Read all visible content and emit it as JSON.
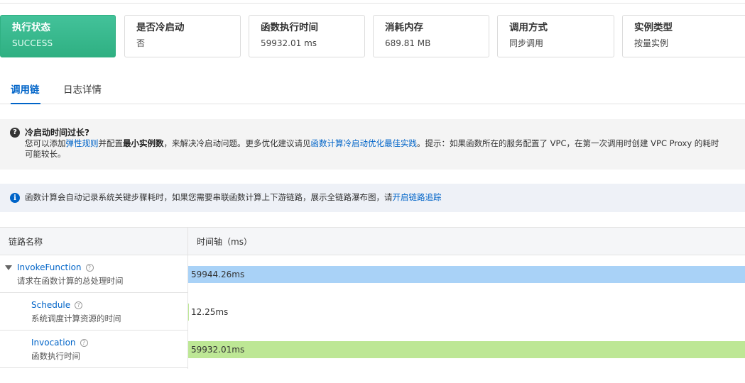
{
  "summary": {
    "status": {
      "title": "执行状态",
      "value": "SUCCESS"
    },
    "cold_start": {
      "title": "是否冷启动",
      "value": "否"
    },
    "duration": {
      "title": "函数执行时间",
      "value": "59932.01 ms"
    },
    "memory": {
      "title": "消耗内存",
      "value": "689.81 MB"
    },
    "invoke_type": {
      "title": "调用方式",
      "value": "同步调用"
    },
    "instance_type": {
      "title": "实例类型",
      "value": "按量实例"
    }
  },
  "tabs": [
    {
      "label": "调用链",
      "active": true
    },
    {
      "label": "日志详情",
      "active": false
    }
  ],
  "cold_tip": {
    "title": "冷启动时间过长?",
    "part1": "您可以添加",
    "link1": "弹性规则",
    "part2": "并配置",
    "bold": "最小实例数",
    "part3": "，来解决冷启动问题。更多优化建议请见",
    "link2": "函数计算冷启动优化最佳实践",
    "part4": "。提示：如果函数所在的服务配置了 VPC，在第一次调用时创建 VPC Proxy 的耗时可能较长。"
  },
  "info": {
    "text": "函数计算会自动记录系统关键步骤耗时，如果您需要串联函数计算上下游链路，展示全链路瀑布图，请",
    "link": "开启链路追踪"
  },
  "table": {
    "col_name": "链路名称",
    "col_time": "时间轴（ms）"
  },
  "spans": [
    {
      "name": "InvokeFunction",
      "desc": "请求在函数计算的总处理时间",
      "label": "59944.26ms",
      "duration_ms": 59944.26,
      "color": "#a9d2f7"
    },
    {
      "name": "Schedule",
      "desc": "系统调度计算资源的时间",
      "label": "12.25ms",
      "duration_ms": 12.25,
      "color": "#bde795"
    },
    {
      "name": "Invocation",
      "desc": "函数执行时间",
      "label": "59932.01ms",
      "duration_ms": 59932.01,
      "color": "#bde795"
    }
  ],
  "icons": {
    "help": "question-circle-icon",
    "info": "info-circle-icon",
    "expand": "triangle-down-icon"
  }
}
